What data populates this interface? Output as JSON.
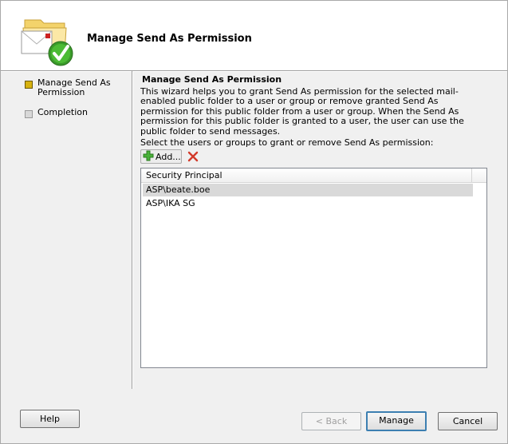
{
  "header": {
    "title": "Manage Send As Permission"
  },
  "steps": [
    {
      "label": "Manage Send As Permission",
      "state": "active"
    },
    {
      "label": "Completion",
      "state": "pending"
    }
  ],
  "content": {
    "section_title": "Manage Send As Permission",
    "description": "This wizard helps you to grant Send As permission for the selected mail-enabled public folder to a user or group or remove granted Send As permission for this public folder from a user or group. When the Send As permission for this public folder is granted to a user, the user can use the public folder to send messages.",
    "select_label": "Select the users or groups to grant or remove Send As permission:",
    "add_label": "Add...",
    "list": {
      "column": "Security Principal",
      "rows": [
        {
          "text": "ASP\\beate.boe",
          "selected": true
        },
        {
          "text": "ASP\\IKA SG",
          "selected": false
        }
      ]
    }
  },
  "footer": {
    "help": "Help",
    "back": "< Back",
    "manage": "Manage",
    "cancel": "Cancel"
  },
  "colors": {
    "active_step": "#d7b20f",
    "selected_row": "#d9d9d9"
  }
}
